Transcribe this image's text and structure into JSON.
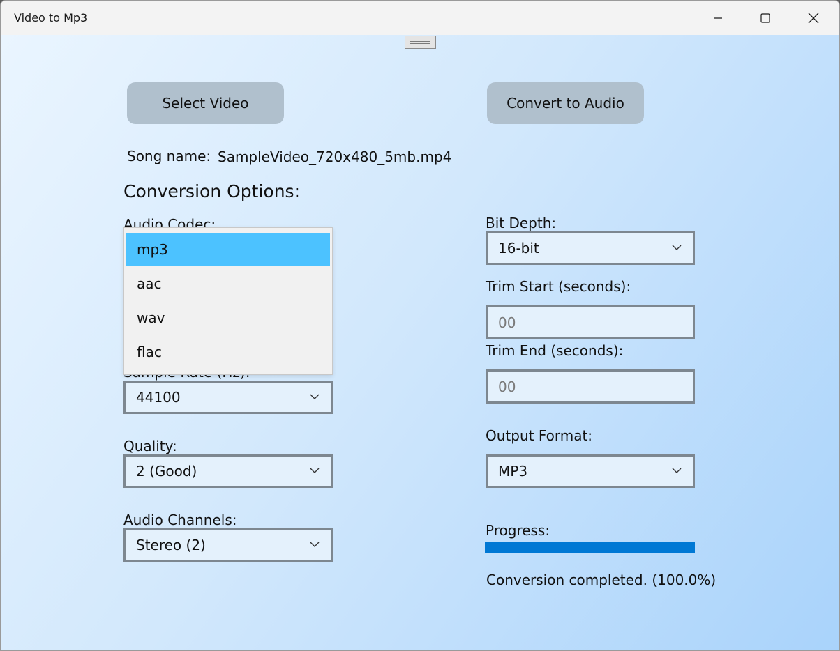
{
  "window": {
    "title": "Video to Mp3"
  },
  "buttons": {
    "select_video": "Select Video",
    "convert": "Convert to Audio"
  },
  "song": {
    "label": "Song name:",
    "value": "SampleVideo_720x480_5mb.mp4"
  },
  "options": {
    "heading": "Conversion Options:",
    "audio_codec": {
      "label": "Audio Codec:",
      "options": [
        "mp3",
        "aac",
        "wav",
        "flac"
      ],
      "highlighted": "mp3"
    },
    "sample_rate": {
      "label": "Sample Rate (Hz):",
      "value": "44100"
    },
    "quality": {
      "label": "Quality:",
      "value": "2 (Good)"
    },
    "audio_channels": {
      "label": "Audio Channels:",
      "value": "Stereo (2)"
    },
    "bit_depth": {
      "label": "Bit Depth:",
      "value": "16-bit"
    },
    "trim_start": {
      "label": "Trim Start (seconds):",
      "placeholder": "00"
    },
    "trim_end": {
      "label": "Trim End (seconds):",
      "placeholder": "00"
    },
    "output_format": {
      "label": "Output Format:",
      "value": "MP3"
    }
  },
  "progress": {
    "label": "Progress:",
    "percent": 100,
    "status": "Conversion completed. (100.0%)"
  },
  "colors": {
    "accent": "#0078d4",
    "dropdown_highlight": "#4cc2ff",
    "button_bg": "#b0c0cd",
    "field_bg": "#e4f1fc"
  }
}
